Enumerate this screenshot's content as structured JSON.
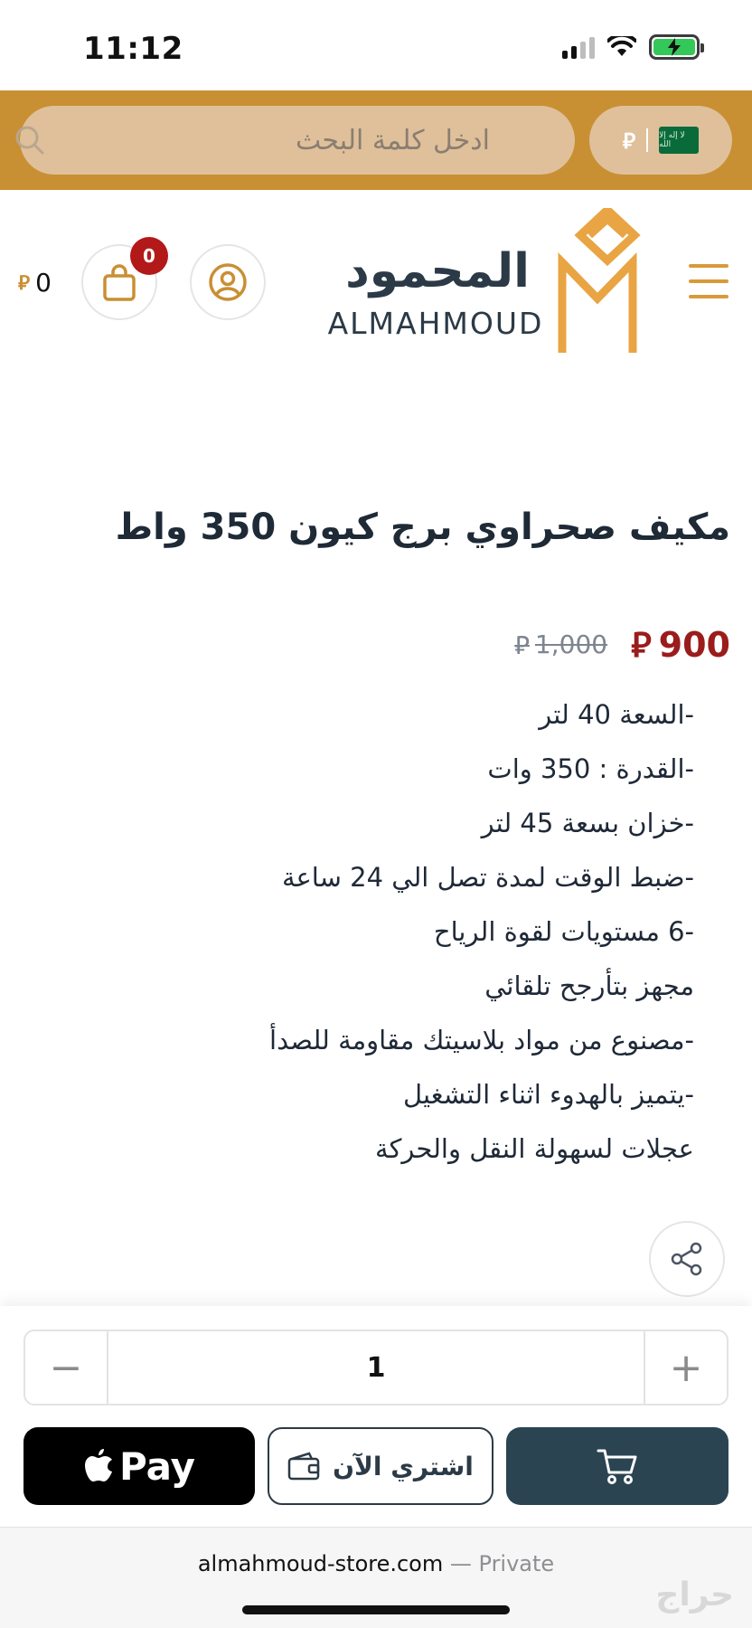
{
  "status_bar": {
    "time": "11:12"
  },
  "header": {
    "search_placeholder": "ادخل كلمة البحث",
    "currency_symbol": "⃁",
    "flag_text": "لا إله إلا الله"
  },
  "brand": {
    "arabic": "المحمود",
    "english": "ALMAHMOUD",
    "logo_color": "#e9a443"
  },
  "cart": {
    "badge_count": "0",
    "total_value": "0",
    "currency_symbol": "⃁"
  },
  "product": {
    "title": "مكيف صحراوي برج كيون 350 واط",
    "price_now": "900",
    "price_was": "1,000",
    "currency_symbol": "⃁",
    "features": [
      "-السعة 40 لتر",
      "-القدرة : 350 وات",
      "-خزان بسعة 45 لتر",
      "-ضبط الوقت لمدة تصل الي 24 ساعة",
      "-6 مستويات لقوة الرياح",
      "مجهز بتأرجح تلقائي",
      "-مصنوع من مواد بلاسيتك مقاومة للصدأ",
      "-يتميز بالهدوء اثناء التشغيل",
      "عجلات لسهولة النقل والحركة"
    ]
  },
  "purchase": {
    "quantity": "1",
    "minus_label": "−",
    "plus_label": "+",
    "applepay_label": "Pay",
    "buy_now_label": "اشتري الآن"
  },
  "browser": {
    "domain": "almahmoud-store.com",
    "separator": " — ",
    "private_label": "Private",
    "watermark": "حراج"
  },
  "colors": {
    "brand_gold": "#c98f33",
    "price_red": "#9b1c1c",
    "dark_teal": "#2b4452"
  }
}
